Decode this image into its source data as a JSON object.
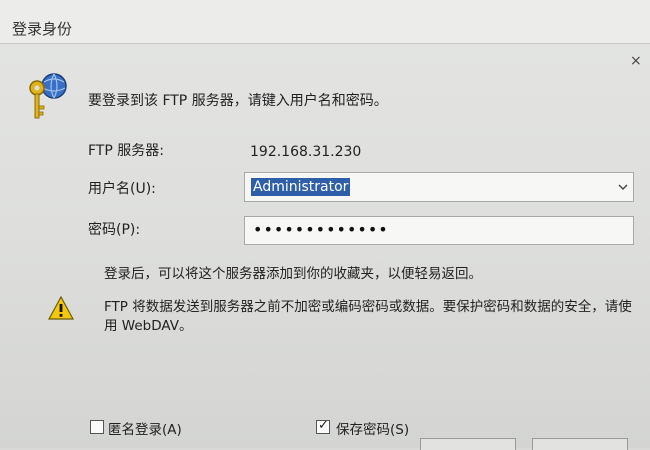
{
  "window": {
    "title": "登录身份",
    "close_glyph": "×"
  },
  "prompt": "要登录到该 FTP 服务器，请键入用户名和密码。",
  "server": {
    "label": "FTP 服务器:",
    "value": "192.168.31.230"
  },
  "username": {
    "label": "用户名(U):",
    "value": "Administrator"
  },
  "password": {
    "label": "密码(P):",
    "masked": "•••••••••••••"
  },
  "hint": "登录后，可以将这个服务器添加到你的收藏夹，以便轻易返回。",
  "warning": "FTP 将数据发送到服务器之前不加密或编码密码或数据。要保护密码和数据的安全，请使用 WebDAV。",
  "options": {
    "anonymous": {
      "label": "匿名登录(A)",
      "checked": false
    },
    "save_password": {
      "label": "保存密码(S)",
      "checked": true
    }
  },
  "icons": {
    "header": "key-globe-icon",
    "warning": "warning-icon",
    "dropdown": "chevron-down-icon"
  },
  "colors": {
    "selection": "#2f5fa8",
    "warning_yellow": "#f2c80f"
  }
}
